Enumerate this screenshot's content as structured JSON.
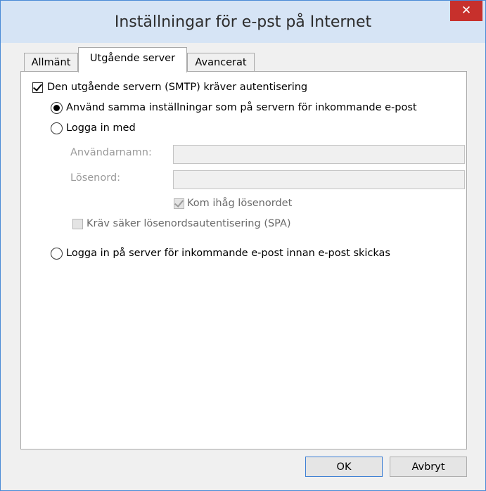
{
  "window": {
    "title": "Inställningar för e-pst på Internet",
    "close_symbol": "✕"
  },
  "tabs": [
    {
      "label": "Allmänt",
      "selected": false
    },
    {
      "label": "Utgående server",
      "selected": true
    },
    {
      "label": "Avancerat",
      "selected": false
    }
  ],
  "smtp_auth": {
    "label": "Den utgående servern (SMTP) kräver autentisering",
    "checked": true
  },
  "radio_same_settings": {
    "label": "Använd samma inställningar som på servern för inkommande e-post",
    "selected": true
  },
  "radio_login_with": {
    "label": "Logga in med",
    "selected": false
  },
  "username": {
    "label": "Användarnamn:",
    "value": ""
  },
  "password": {
    "label": "Lösenord:",
    "value": ""
  },
  "remember_password": {
    "label": "Kom ihåg lösenordet",
    "checked": true,
    "enabled": false
  },
  "require_spa": {
    "label": "Kräv säker lösenordsautentisering (SPA)",
    "checked": false,
    "enabled": false
  },
  "radio_login_incoming_first": {
    "label": "Logga in på server för inkommande e-post innan e-post skickas",
    "selected": false
  },
  "buttons": {
    "ok": "OK",
    "cancel": "Avbryt"
  },
  "colors": {
    "titlebar": "#d6e4f5",
    "close_button": "#c7302c",
    "window_border": "#4a8ad6",
    "disabled_text": "#9a9a9a"
  }
}
